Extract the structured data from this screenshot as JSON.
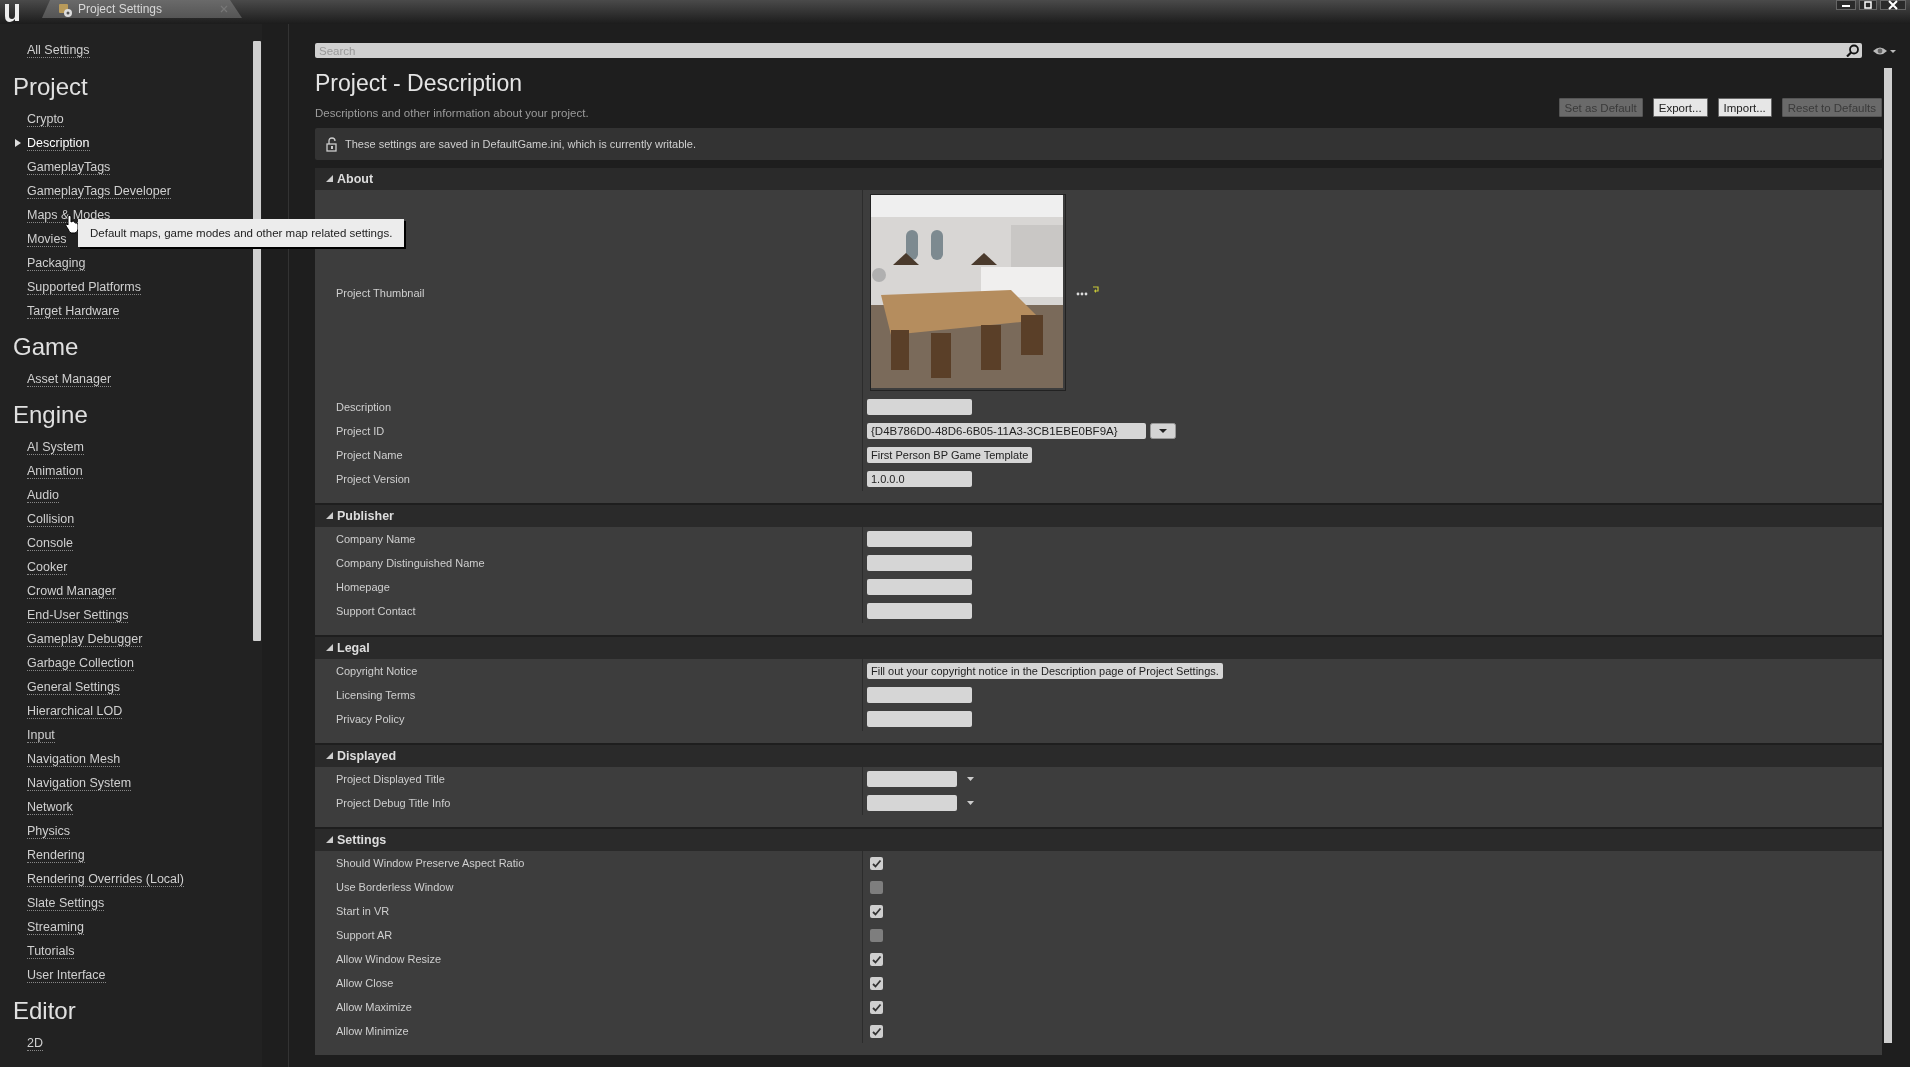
{
  "window": {
    "tab_title": "Project Settings"
  },
  "sidebar": {
    "top_link": "All Settings",
    "groups": [
      {
        "title": "Project",
        "items": [
          {
            "label": "Crypto",
            "selected": false
          },
          {
            "label": "Description",
            "selected": true
          },
          {
            "label": "GameplayTags",
            "selected": false
          },
          {
            "label": "GameplayTags Developer",
            "selected": false
          },
          {
            "label": "Maps & Modes",
            "selected": false
          },
          {
            "label": "Movies",
            "selected": false
          },
          {
            "label": "Packaging",
            "selected": false
          },
          {
            "label": "Supported Platforms",
            "selected": false
          },
          {
            "label": "Target Hardware",
            "selected": false
          }
        ]
      },
      {
        "title": "Game",
        "items": [
          {
            "label": "Asset Manager",
            "selected": false
          }
        ]
      },
      {
        "title": "Engine",
        "items": [
          {
            "label": "AI System",
            "selected": false
          },
          {
            "label": "Animation",
            "selected": false
          },
          {
            "label": "Audio",
            "selected": false
          },
          {
            "label": "Collision",
            "selected": false
          },
          {
            "label": "Console",
            "selected": false
          },
          {
            "label": "Cooker",
            "selected": false
          },
          {
            "label": "Crowd Manager",
            "selected": false
          },
          {
            "label": "End-User Settings",
            "selected": false
          },
          {
            "label": "Gameplay Debugger",
            "selected": false
          },
          {
            "label": "Garbage Collection",
            "selected": false
          },
          {
            "label": "General Settings",
            "selected": false
          },
          {
            "label": "Hierarchical LOD",
            "selected": false
          },
          {
            "label": "Input",
            "selected": false
          },
          {
            "label": "Navigation Mesh",
            "selected": false
          },
          {
            "label": "Navigation System",
            "selected": false
          },
          {
            "label": "Network",
            "selected": false
          },
          {
            "label": "Physics",
            "selected": false
          },
          {
            "label": "Rendering",
            "selected": false
          },
          {
            "label": "Rendering Overrides (Local)",
            "selected": false
          },
          {
            "label": "Slate Settings",
            "selected": false
          },
          {
            "label": "Streaming",
            "selected": false
          },
          {
            "label": "Tutorials",
            "selected": false
          },
          {
            "label": "User Interface",
            "selected": false
          }
        ]
      },
      {
        "title": "Editor",
        "items": [
          {
            "label": "2D",
            "selected": false
          }
        ]
      }
    ]
  },
  "tooltip": {
    "text": "Default maps, game modes and other map related settings."
  },
  "search": {
    "placeholder": "Search"
  },
  "page": {
    "title": "Project - Description",
    "subtitle": "Descriptions and other information about your project.",
    "buttons": [
      {
        "label": "Set as Default",
        "disabled": true
      },
      {
        "label": "Export...",
        "disabled": false
      },
      {
        "label": "Import...",
        "disabled": false
      },
      {
        "label": "Reset to Defaults",
        "disabled": true
      }
    ],
    "notice": "These settings are saved in DefaultGame.ini, which is currently writable."
  },
  "sections": [
    {
      "title": "About",
      "expanded": true,
      "rows": [
        {
          "label": "Project Thumbnail"
        },
        {
          "kind": "text",
          "label": "Description"
        },
        {
          "kind": "combo",
          "label": "Project ID",
          "value": "{D4B786D0-48D6-6B05-11A3-3CB1EBE0BF9A}"
        },
        {
          "kind": "text",
          "label": "Project Name",
          "value": "First Person BP Game Template"
        },
        {
          "kind": "text",
          "label": "Project Version",
          "value": "1.0.0.0"
        }
      ]
    },
    {
      "title": "Publisher",
      "expanded": true,
      "rows": [
        {
          "kind": "text",
          "label": "Company Name"
        },
        {
          "kind": "text",
          "label": "Company Distinguished Name"
        },
        {
          "kind": "text",
          "label": "Homepage"
        },
        {
          "kind": "text",
          "label": "Support Contact"
        }
      ]
    },
    {
      "title": "Legal",
      "expanded": true,
      "rows": [
        {
          "kind": "text",
          "label": "Copyright Notice",
          "value": "Fill out your copyright notice in the Description page of Project Settings."
        },
        {
          "kind": "text",
          "label": "Licensing Terms"
        },
        {
          "kind": "text",
          "label": "Privacy Policy"
        }
      ]
    },
    {
      "title": "Displayed",
      "expanded": true,
      "rows": [
        {
          "kind": "dropdown",
          "label": "Project Displayed Title"
        },
        {
          "kind": "dropdown",
          "label": "Project Debug Title Info"
        }
      ]
    },
    {
      "title": "Settings",
      "expanded": true,
      "rows": [
        {
          "kind": "checkbox",
          "label": "Should Window Preserve Aspect Ratio",
          "checked": true
        },
        {
          "kind": "checkbox",
          "label": "Use Borderless Window",
          "checked": false
        },
        {
          "kind": "checkbox",
          "label": "Start in VR",
          "checked": true
        },
        {
          "kind": "checkbox",
          "label": "Support AR",
          "checked": false
        },
        {
          "kind": "checkbox",
          "label": "Allow Window Resize",
          "checked": true
        },
        {
          "kind": "checkbox",
          "label": "Allow Close",
          "checked": true
        },
        {
          "kind": "checkbox",
          "label": "Allow Maximize",
          "checked": true
        },
        {
          "kind": "checkbox",
          "label": "Allow Minimize",
          "checked": true
        }
      ]
    }
  ]
}
